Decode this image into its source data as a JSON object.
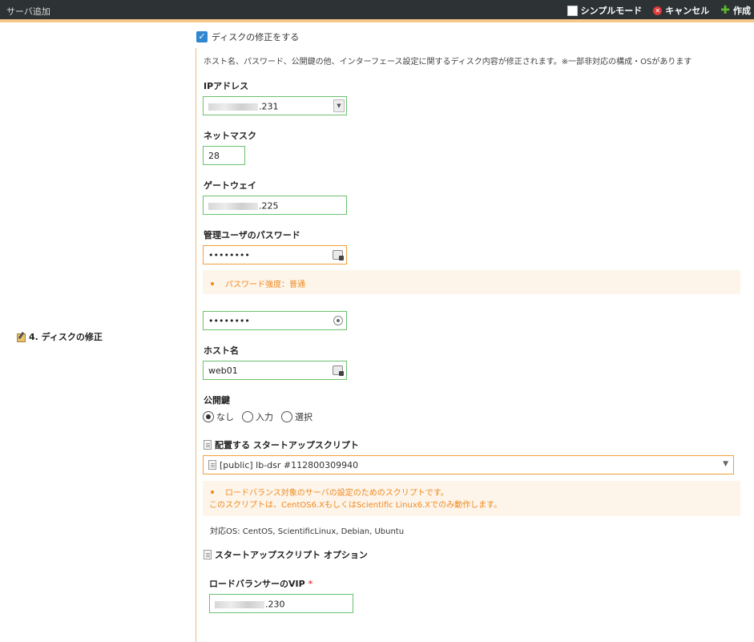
{
  "header": {
    "title": "サーバ追加",
    "simple_mode_label": "シンプルモード",
    "cancel_label": "キャンセル",
    "create_label": "作成"
  },
  "section": {
    "label": "4. ディスクの修正"
  },
  "disk_edit": {
    "checkbox_label": "ディスクの修正をする",
    "checked": true,
    "description": "ホスト名、パスワード、公開鍵の他、インターフェース設定に関するディスク内容が修正されます。※一部非対応の構成・OSがあります"
  },
  "ip": {
    "label": "IPアドレス",
    "suffix": ".231"
  },
  "netmask": {
    "label": "ネットマスク",
    "value": "28"
  },
  "gateway": {
    "label": "ゲートウェイ",
    "suffix": ".225"
  },
  "password": {
    "label": "管理ユーザのパスワード",
    "value": "••••••••",
    "strength_text": "パスワード強度：普通",
    "confirm_value": "••••••••"
  },
  "hostname": {
    "label": "ホスト名",
    "value": "web01"
  },
  "pubkey": {
    "label": "公開鍵",
    "options": [
      "なし",
      "入力",
      "選択"
    ],
    "selected": "なし"
  },
  "startup": {
    "label": "配置する スタートアップスクリプト",
    "selected_script": "[public] lb-dsr #112800309940",
    "notice_line1": "ロードバランス対象のサーバの設定のためのスクリプトです。",
    "notice_line2": "このスクリプトは、CentOS6.XもしくはScientific Linux6.Xでのみ動作します。",
    "supported_os": "対応OS: CentOS, ScientificLinux, Debian, Ubuntu",
    "options_label": "スタートアップスクリプト オプション",
    "vip_label": "ロードバランサーのVIP",
    "vip_required_mark": "*",
    "vip_suffix": ".230"
  }
}
